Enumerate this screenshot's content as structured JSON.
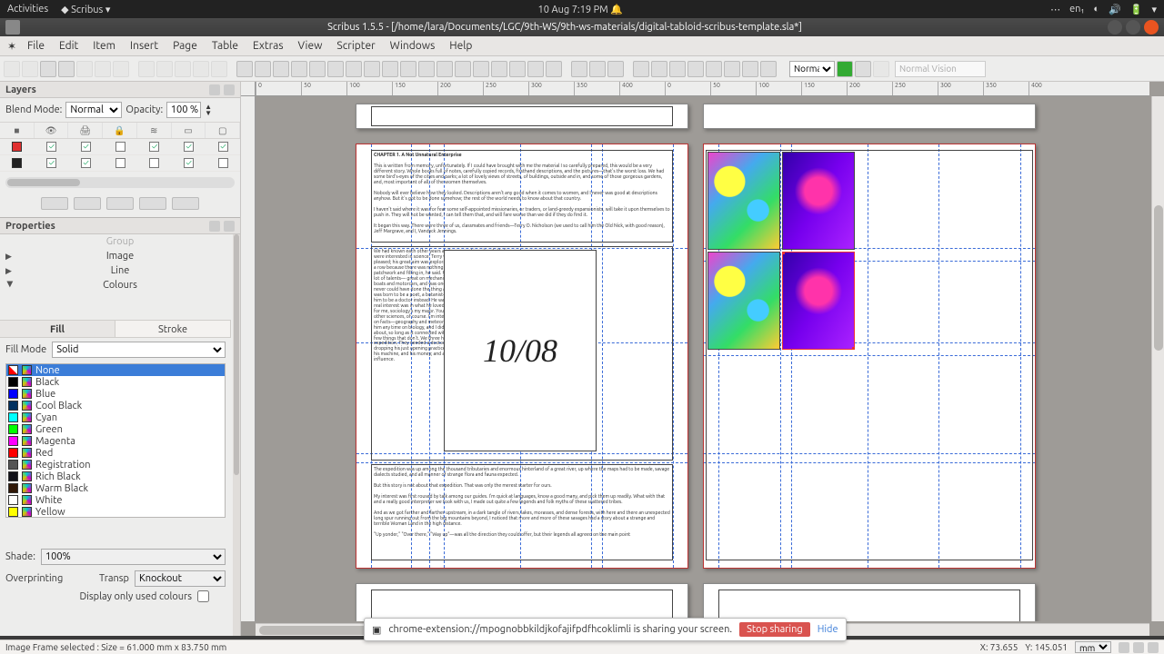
{
  "sysbar": {
    "activities": "Activities",
    "appmenu": "Scribus ▾",
    "clock": "10 Aug   7:19 PM",
    "lang": "en₁"
  },
  "titlebar": {
    "title": "Scribus 1.5.5 - [/home/lara/Documents/LGC/9th-WS/9th-ws-materials/digital-tabloid-scribus-template.sla*]"
  },
  "menu": [
    "File",
    "Edit",
    "Item",
    "Insert",
    "Page",
    "Table",
    "Extras",
    "View",
    "Scripter",
    "Windows",
    "Help"
  ],
  "toolbar": {
    "view_mode": "Normal",
    "vision": "Normal Vision"
  },
  "layers": {
    "title": "Layers",
    "blend_label": "Blend Mode:",
    "blend_value": "Normal",
    "opacity_label": "Opacity:",
    "opacity_value": "100 %",
    "rows": [
      {
        "color": "#e03030",
        "checks": [
          true,
          true,
          false,
          true,
          true,
          true
        ]
      },
      {
        "color": "#222222",
        "checks": [
          true,
          true,
          false,
          false,
          true,
          false
        ]
      }
    ]
  },
  "properties": {
    "title": "Properties",
    "sections": {
      "group": "Group",
      "image": "Image",
      "line": "Line",
      "colours": "Colours"
    },
    "tabs": {
      "fill": "Fill",
      "stroke": "Stroke"
    },
    "fillmode_label": "Fill Mode",
    "fillmode_value": "Solid",
    "colors": [
      {
        "name": "None",
        "hex": "transparent",
        "sel": true
      },
      {
        "name": "Black",
        "hex": "#000000"
      },
      {
        "name": "Blue",
        "hex": "#0000ff"
      },
      {
        "name": "Cool Black",
        "hex": "#003060"
      },
      {
        "name": "Cyan",
        "hex": "#00ffff"
      },
      {
        "name": "Green",
        "hex": "#00ff00"
      },
      {
        "name": "Magenta",
        "hex": "#ff00ff"
      },
      {
        "name": "Red",
        "hex": "#ff0000"
      },
      {
        "name": "Registration",
        "hex": "#555555"
      },
      {
        "name": "Rich Black",
        "hex": "#101018"
      },
      {
        "name": "Warm Black",
        "hex": "#301808"
      },
      {
        "name": "White",
        "hex": "#ffffff"
      },
      {
        "name": "Yellow",
        "hex": "#ffff00"
      }
    ],
    "shade_label": "Shade:",
    "shade_value": "100%",
    "overprint_label": "Overprinting",
    "trans_label": "Transp",
    "knockout": "Knockout",
    "display_only": "Display only used colours"
  },
  "document": {
    "bigdate": "10/08",
    "chapter_title": "CHAPTER 1. A Not Unnatural Enterprise",
    "body1": "This is written from memory, unfortunately. If I could have brought with me the material I so carefully prepared, this would be a very different story. Whole books full of notes, carefully copied records, firsthand descriptions, and the pictures—that's the worst loss. We had some bird's-eyes of the cities and parks; a lot of lovely views of streets, of buildings, outside and in, and some of those gorgeous gardens, and, most important of all, of the women themselves.",
    "body2": "Nobody will ever believe how they looked. Descriptions aren't any good when it comes to women, and I never was good at descriptions anyhow. But it's got to be done somehow; the rest of the world needs to know about that country.",
    "body3": "I haven't said where it was for fear some self-appointed missionaries, or traders, or land-greedy expansionists, will take it upon themselves to push in. They will not be wanted, I can tell them that, and will fare worse than we did if they do find it.",
    "body4": "It began this way. There were three of us, classmates and friends—Terry O. Nicholson (we used to call him the Old Nick, with good reason), Jeff Margrave, and I, Vandyck Jennings.",
    "left_col": "We had known each other years and years, and in spite of all of us were interested in science. Terry was rich enough to do as he pleased; his great aim was exploration. He used to make all kinds of a row because there was nothing left to explore now, only patchwork and filling in, he said. He filled in well enough —he had a lot of talents— great on mechanics and electricity. Had all kinds of boats and motorcars, and was one of the best of our airmen. We never could have done the thing at all without Terry. Jeff Margrave was born to be a poet, a botanist—or both—but his folks persuaded him to be a doctor instead. He was a good one, for his age, but his real interest was in what he loved to call 'the wonders of science.' As for me, sociology's my major. You have to back that up with a lot of other sciences, of course. I'm interested in them all. Terry was strong on facts—geography and meteorology and those; Jeff could beat him any time on biology, and I didn't care what it was they talked about, so long as it connected with human life, somehow. There are few things that don't. We three had a chance to join a big scientific expedition. They needed a doctor, and that gave Jeff an excuse for dropping his just opening practice; they needed Terry's experience, his machine, and his money; and as for me, I got in through Terry's influence.",
    "body5": "The expedition was up among the thousand tributaries and enormous hinterland of a great river, up where the maps had to be made, savage dialects studied, and all manner of strange flora and fauna expected.",
    "body6": "But this story is not about that expedition. That was only the merest starter for ours.",
    "body7": "My interest was first roused by talk among our guides. I'm quick at languages, know a good many, and pick them up readily. What with that and a really good interpreter we took with us, I made out quite a few legends and folk myths of these scattered tribes.",
    "body8": "And as we got farther and farther upstream, in a dark tangle of rivers, lakes, morasses, and dense forests, with here and there an unexpected long spur running out from the big mountains beyond, I noticed that more and more of these savages had a story about a strange and terrible Woman Land in the high distance.",
    "body9": "\"Up yonder,\" \"Over there,\" \"Way up\"—was all the direction they could offer, but their legends all agreed on the main point"
  },
  "sharebar": {
    "text": "chrome-extension://mpognobbkildjkofajifpdfhcoklimli is sharing your screen.",
    "stop": "Stop sharing",
    "hide": "Hide"
  },
  "status": {
    "selection": "Image Frame selected  : Size = 61.000 mm x 83.750 mm",
    "x_label": "X:",
    "x": "73.655",
    "y_label": "Y:",
    "y": "145.051",
    "unit": "mm"
  },
  "ruler_marks": [
    "0",
    "50",
    "100",
    "150",
    "200",
    "250",
    "300",
    "350",
    "400",
    "0",
    "50",
    "100",
    "150",
    "200",
    "250",
    "300",
    "350",
    "400"
  ]
}
